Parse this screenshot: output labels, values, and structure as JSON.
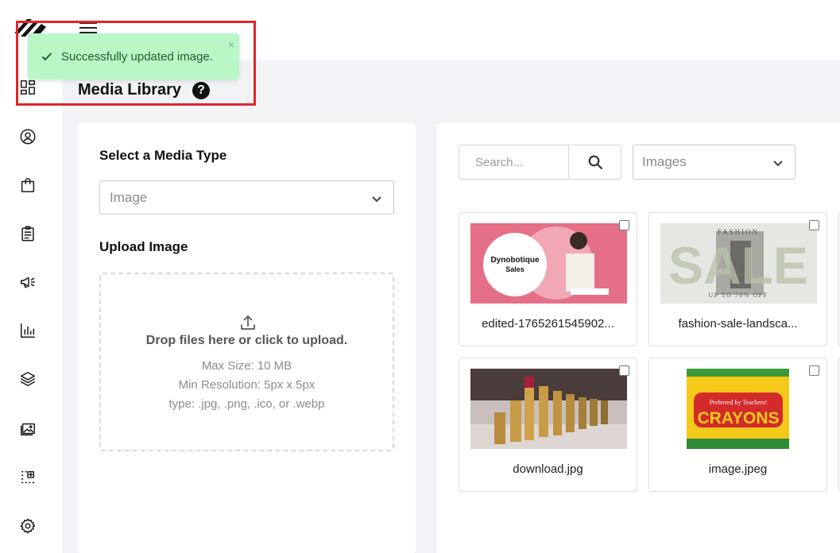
{
  "toast": {
    "message": "Successfully updated image.",
    "close": "×"
  },
  "page": {
    "title": "Media Library",
    "help": "?"
  },
  "upload_panel": {
    "media_type_label": "Select a Media Type",
    "media_type_value": "Image",
    "upload_label": "Upload Image",
    "drop_title": "Drop files here or click to upload.",
    "max_size": "Max Size: 10 MB",
    "min_resolution": "Min Resolution: 5px x 5px",
    "file_types": "type: .jpg, .png, .ico, or .webp"
  },
  "library": {
    "search_placeholder": "Search...",
    "filter_value": "Images",
    "items": [
      {
        "filename": "edited-1765261545902...",
        "thumb_text": [
          "Dynobotique",
          "Sales"
        ]
      },
      {
        "filename": "fashion-sale-landsca...",
        "thumb_text": [
          "FASHION",
          "SALE",
          "UP TO 70% OFF"
        ]
      },
      {
        "filename": "download.jpg"
      },
      {
        "filename": "image.jpeg",
        "thumb_text": [
          "Preferred by Teachers!",
          "CRAYONS"
        ]
      }
    ]
  },
  "icons": {
    "sidebar": [
      "dashboard-icon",
      "user-icon",
      "shopping-bag-icon",
      "clipboard-icon",
      "megaphone-icon",
      "bar-chart-icon",
      "layers-icon",
      "media-folder-icon",
      "add-grid-icon",
      "settings-icon"
    ]
  },
  "colors": {
    "toast_bg": "#b9f7c6",
    "toast_text": "#1f5b2c",
    "highlight": "#e0252a"
  }
}
